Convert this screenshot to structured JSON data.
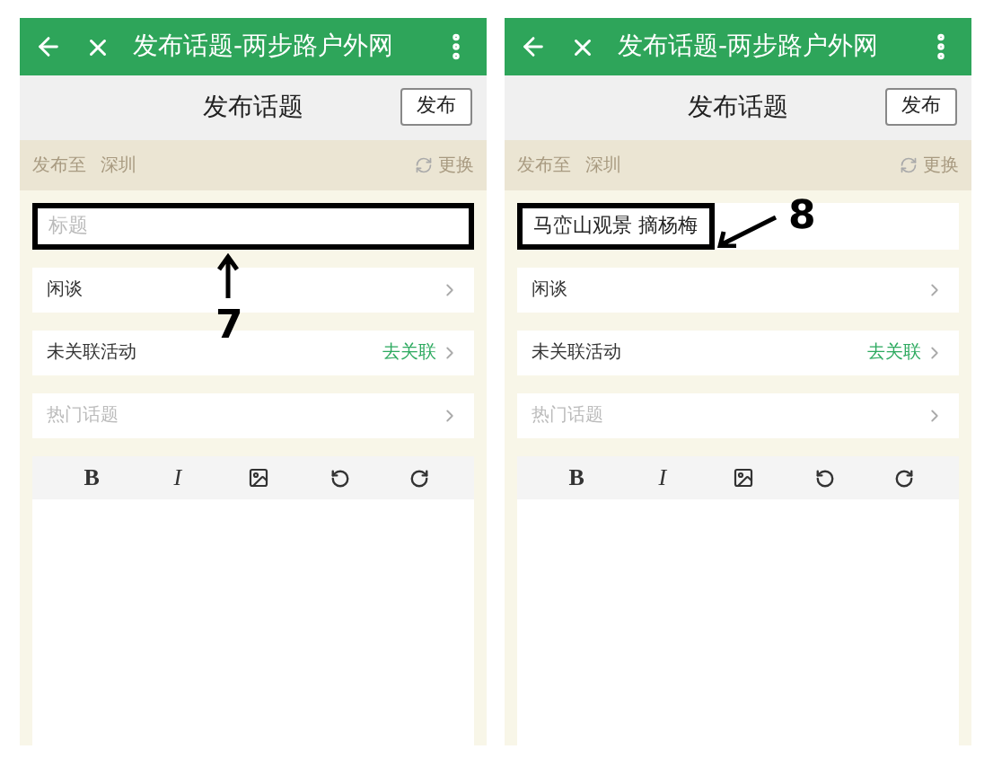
{
  "screens": [
    {
      "window_title": "发布话题-两步路户外网",
      "page_title": "发布话题",
      "publish_button": "发布",
      "location_label": "发布至",
      "location_value": "深圳",
      "change_label": "更换",
      "title_field": {
        "placeholder": "标题"
      },
      "rows": [
        {
          "label": "闲谈",
          "muted": false
        },
        {
          "label": "未关联活动",
          "muted": false,
          "action": "去关联"
        },
        {
          "label": "热门话题",
          "muted": true
        }
      ],
      "toolbar": [
        {
          "kind": "bold",
          "label": "B"
        },
        {
          "kind": "italic",
          "label": "I"
        },
        {
          "kind": "image"
        },
        {
          "kind": "undo"
        },
        {
          "kind": "redo"
        }
      ],
      "annotation": {
        "kind": "below",
        "label": "7"
      }
    },
    {
      "window_title": "发布话题-两步路户外网",
      "page_title": "发布话题",
      "publish_button": "发布",
      "location_label": "发布至",
      "location_value": "深圳",
      "change_label": "更换",
      "title_field": {
        "value": "马峦山观景 摘杨梅"
      },
      "rows": [
        {
          "label": "闲谈",
          "muted": false
        },
        {
          "label": "未关联活动",
          "muted": false,
          "action": "去关联"
        },
        {
          "label": "热门话题",
          "muted": true
        }
      ],
      "toolbar": [
        {
          "kind": "bold",
          "label": "B"
        },
        {
          "kind": "italic",
          "label": "I"
        },
        {
          "kind": "image"
        },
        {
          "kind": "undo"
        },
        {
          "kind": "redo"
        }
      ],
      "annotation": {
        "kind": "right",
        "label": "8"
      }
    }
  ]
}
